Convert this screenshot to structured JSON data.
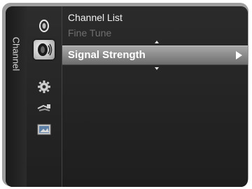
{
  "side_tab": {
    "label": "Channel"
  },
  "menu": {
    "items": [
      {
        "label": "Channel List",
        "state": "normal"
      },
      {
        "label": "Fine Tune",
        "state": "disabled"
      },
      {
        "label": "Signal Strength",
        "state": "selected"
      }
    ]
  },
  "icons": [
    "picture-icon",
    "channel-icon",
    "setup-icon",
    "input-icon",
    "application-icon"
  ],
  "colors": {
    "panel_bg": "#2a2a2a",
    "selected_bar": "#8a8a8a",
    "frame": "#9e9e9e"
  }
}
